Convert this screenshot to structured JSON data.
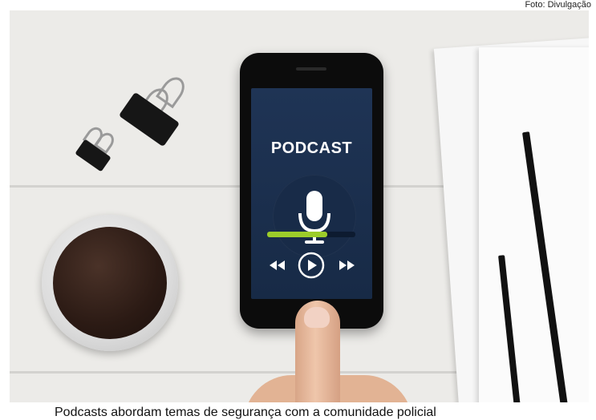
{
  "photo_credit": "Foto: Divulgação",
  "phone_app": {
    "title": "PODCAST",
    "progress_fraction": 0.68,
    "accent_color": "#9ccd2a",
    "screen_color": "#1f3455",
    "icons": {
      "microphone": "microphone-icon",
      "rewind": "rewind-icon",
      "play": "play-icon",
      "fast_forward": "fast-forward-icon"
    }
  },
  "caption": "Podcasts abordam temas de segurança com a comunidade policial"
}
